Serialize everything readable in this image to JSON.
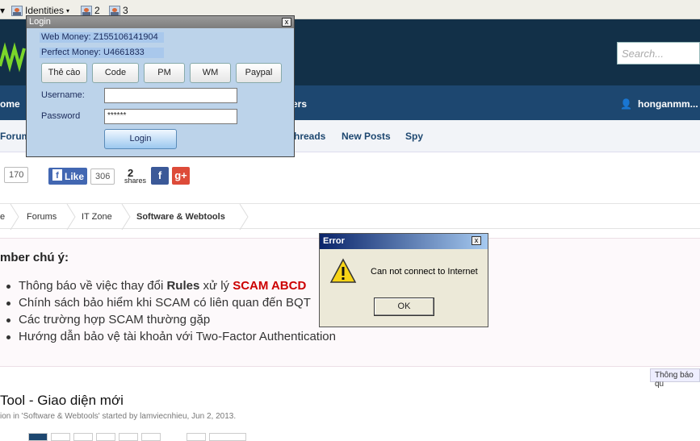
{
  "toolbar": {
    "identities_label": "Identities",
    "id2": "2",
    "id3": "3"
  },
  "header": {
    "search_placeholder": "Search..."
  },
  "nav": {
    "item_home": "ome",
    "item_members": "ers",
    "user": "honganmm..."
  },
  "subnav": {
    "forum": "Forum",
    "threads": "hreads",
    "new_posts": "New Posts",
    "spy": "Spy"
  },
  "share": {
    "count1": "170",
    "fb_like": "Like",
    "fb_count": "306",
    "shares_num": "2",
    "shares_label": "shares",
    "fb": "f",
    "gplus": "g+"
  },
  "breadcrumb": {
    "c0": "e",
    "c1": "Forums",
    "c2": "IT Zone",
    "c3": "Software & Webtools"
  },
  "notice": {
    "title": "mber chú ý:",
    "items": [
      {
        "pre": "Thông báo về việc thay đổi ",
        "bold": "Rules",
        "mid": " xử lý ",
        "red": "SCAM ABCD"
      },
      {
        "text": "Chính sách bảo hiểm khi SCAM có liên quan đến BQT"
      },
      {
        "text": "Các trường hợp SCAM thường gặp"
      },
      {
        "text": "Hướng dẫn bảo vệ tài khoản với Two-Factor Authentication"
      }
    ],
    "tab": "Thông báo qu"
  },
  "thread": {
    "title": "Tool - Giao diện mới",
    "meta": "ion in 'Software & Webtools' started by lamviecnhieu, Jun 2, 2013."
  },
  "login": {
    "title": "Login",
    "close": "x",
    "webmoney": "Web Money: Z155106141904",
    "perfectmoney": "Perfect Money: U4661833",
    "buttons": [
      "Thẻ cào",
      "Code",
      "PM",
      "WM",
      "Paypal"
    ],
    "username_label": "Username:",
    "username_value": "",
    "password_label": "Password",
    "password_value": "******",
    "login_button": "Login"
  },
  "error": {
    "title": "Error",
    "close": "x",
    "message": "Can not connect to Internet",
    "ok": "OK"
  },
  "colors": {
    "header": "#123048",
    "nav": "#1d4770",
    "login_bg": "#bcd3ea",
    "dialog_bg": "#ece9d8",
    "scam_red": "#cc0000"
  }
}
